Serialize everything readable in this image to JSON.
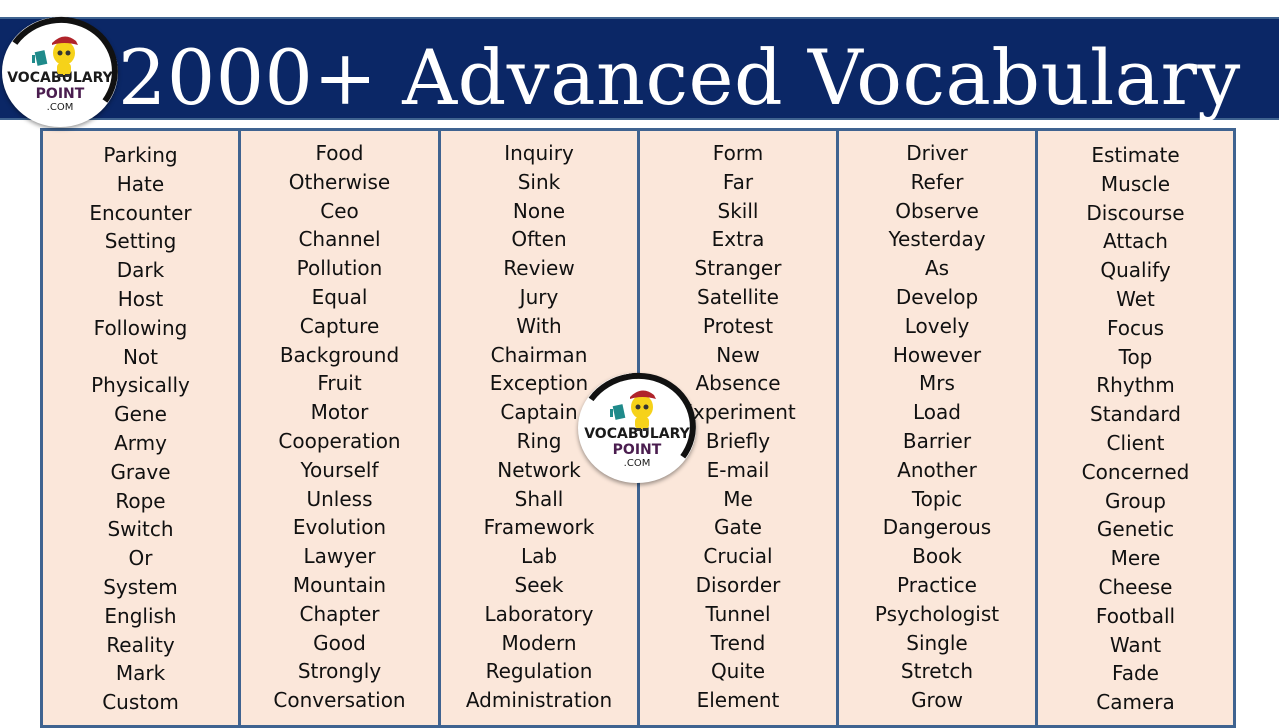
{
  "header": {
    "title": "2000+ Advanced Vocabulary",
    "background_color": "#0b2766",
    "title_color": "#ffffff"
  },
  "logo": {
    "line1": "VOCABULARY",
    "line2": "POINT",
    "line3": ".COM",
    "icon": "mascot-with-book-icon"
  },
  "panel_color": "#fbe7da",
  "border_color": "#3f6390",
  "columns": [
    [
      "Parking",
      "Hate",
      "Encounter",
      "Setting",
      "Dark",
      "Host",
      "Following",
      "Not",
      "Physically",
      "Gene",
      "Army",
      "Grave",
      "Rope",
      "Switch",
      "Or",
      "System",
      "English",
      "Reality",
      "Mark",
      "Custom"
    ],
    [
      "Food",
      "Otherwise",
      "Ceo",
      "Channel",
      "Pollution",
      "Equal",
      "Capture",
      "Background",
      "Fruit",
      "Motor",
      "Cooperation",
      "Yourself",
      "Unless",
      "Evolution",
      "Lawyer",
      "Mountain",
      "Chapter",
      "Good",
      "Strongly",
      "Conversation"
    ],
    [
      "Inquiry",
      "Sink",
      "None",
      "Often",
      "Review",
      "Jury",
      "With",
      "Chairman",
      "Exception",
      "Captain",
      "Ring",
      "Network",
      "Shall",
      "Framework",
      "Lab",
      "Seek",
      "Laboratory",
      "Modern",
      "Regulation",
      "Administration"
    ],
    [
      "Form",
      "Far",
      "Skill",
      "Extra",
      "Stranger",
      "Satellite",
      "Protest",
      "New",
      "Absence",
      "Experiment",
      "Briefly",
      "E-mail",
      "Me",
      "Gate",
      "Crucial",
      "Disorder",
      "Tunnel",
      "Trend",
      "Quite",
      "Element"
    ],
    [
      "Driver",
      "Refer",
      "Observe",
      "Yesterday",
      "As",
      "Develop",
      "Lovely",
      "However",
      "Mrs",
      "Load",
      "Barrier",
      "Another",
      "Topic",
      "Dangerous",
      "Book",
      "Practice",
      "Psychologist",
      "Single",
      "Stretch",
      "Grow"
    ],
    [
      "Estimate",
      "Muscle",
      "Discourse",
      "Attach",
      "Qualify",
      "Wet",
      "Focus",
      "Top",
      "Rhythm",
      "Standard",
      "Client",
      "Concerned",
      "Group",
      "Genetic",
      "Mere",
      "Cheese",
      "Football",
      "Want",
      "Fade",
      "Camera"
    ]
  ]
}
